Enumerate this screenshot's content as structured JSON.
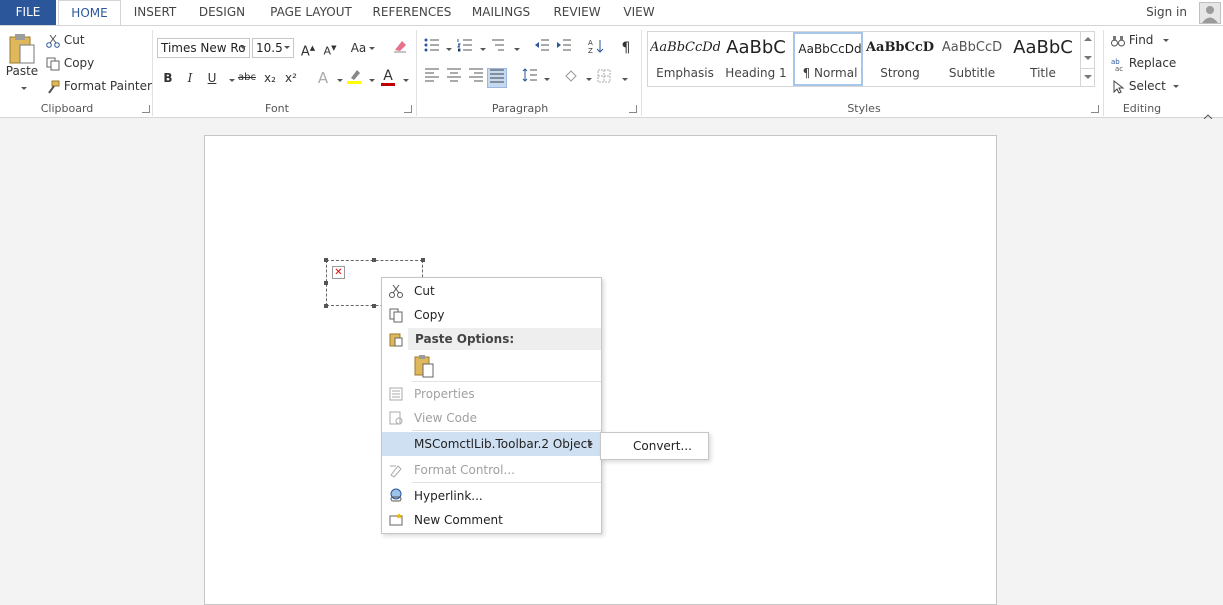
{
  "tabs": {
    "file": "FILE",
    "home": "HOME",
    "insert": "INSERT",
    "design": "DESIGN",
    "page_layout": "PAGE LAYOUT",
    "references": "REFERENCES",
    "mailings": "MAILINGS",
    "review": "REVIEW",
    "view": "VIEW",
    "sign_in": "Sign in"
  },
  "clipboard": {
    "paste": "Paste",
    "cut": "Cut",
    "copy": "Copy",
    "format_painter": "Format Painter",
    "label": "Clipboard"
  },
  "font": {
    "family": "Times New Ro",
    "size": "10.5",
    "grow": "A",
    "shrink": "A",
    "case": "Aa",
    "bold": "B",
    "italic": "I",
    "underline": "U",
    "strike": "abc",
    "subscript": "x₂",
    "superscript": "x²",
    "text_effects": "A",
    "font_color": "A",
    "label": "Font"
  },
  "paragraph": {
    "show_marks": "¶",
    "label": "Paragraph"
  },
  "styles": {
    "tiles": [
      {
        "preview": "AaBbCcDd",
        "name": "Emphasis"
      },
      {
        "preview": "AaBbC",
        "name": "Heading 1"
      },
      {
        "preview": "AaBbCcDd",
        "name": "¶ Normal"
      },
      {
        "preview": "AaBbCcD",
        "name": "Strong"
      },
      {
        "preview": "AaBbCcD",
        "name": "Subtitle"
      },
      {
        "preview": "AaBbC",
        "name": "Title"
      }
    ],
    "label": "Styles"
  },
  "editing": {
    "find": "Find",
    "replace": "Replace",
    "select": "Select",
    "label": "Editing"
  },
  "context_menu": {
    "cut": "Cut",
    "copy": "Copy",
    "paste_options": "Paste Options:",
    "properties": "Properties",
    "view_code": "View Code",
    "object": "MSComctlLib.Toolbar.2 Object",
    "format_control": "Format Control...",
    "hyperlink": "Hyperlink...",
    "new_comment": "New Comment"
  },
  "submenu": {
    "convert": "Convert..."
  },
  "colors": {
    "accent": "#2b579a",
    "highlight": "#cfe0f3",
    "font_color_bar": "#c00000",
    "highlight_bar": "#ffff00"
  }
}
